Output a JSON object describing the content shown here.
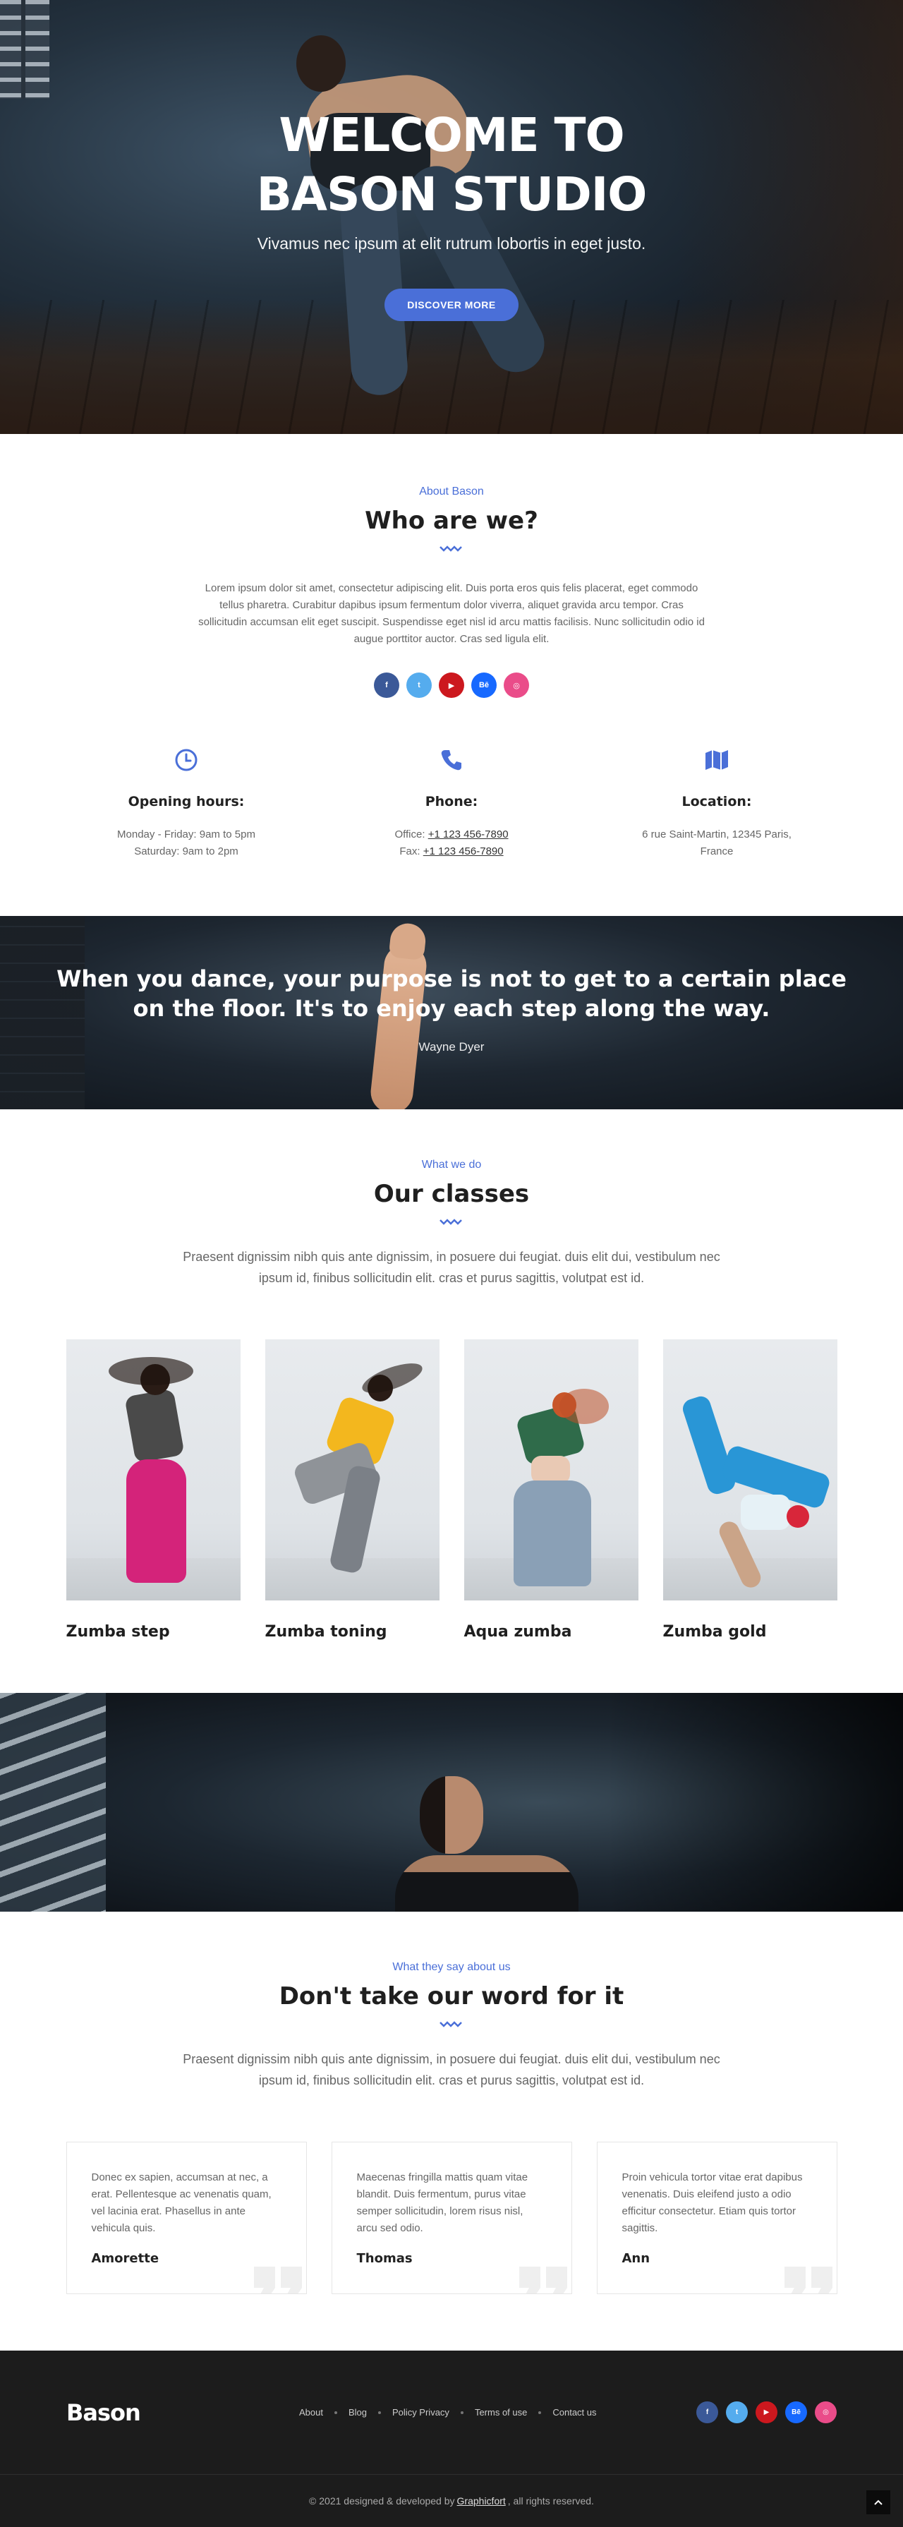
{
  "hero": {
    "title_line1": "WELCOME TO",
    "title_line2": "BASON STUDIO",
    "subtitle": "Vivamus nec ipsum at elit rutrum lobortis in eget justo.",
    "cta": "DISCOVER MORE"
  },
  "about": {
    "eyebrow": "About Bason",
    "title": "Who are we?",
    "text": "Lorem ipsum dolor sit amet, consectetur adipiscing elit. Duis porta eros quis felis placerat, eget commodo tellus pharetra. Curabitur dapibus ipsum fermentum dolor viverra, aliquet gravida arcu tempor. Cras sollicitudin accumsan elit eget suscipit. Suspendisse eget nisl id arcu mattis facilisis. Nunc sollicitudin odio id augue porttitor auctor. Cras sed ligula elit.",
    "socials": [
      {
        "icon": "facebook-icon",
        "glyph": "f",
        "color": "#3b5998"
      },
      {
        "icon": "twitter-icon",
        "glyph": "t",
        "color": "#55acee"
      },
      {
        "icon": "youtube-icon",
        "glyph": "▶",
        "color": "#cc181e"
      },
      {
        "icon": "behance-icon",
        "glyph": "Bē",
        "color": "#1769ff"
      },
      {
        "icon": "dribbble-icon",
        "glyph": "◎",
        "color": "#ea4c89"
      }
    ],
    "hours": {
      "title": "Opening hours:",
      "line1": "Monday - Friday: 9am to 5pm",
      "line2": "Saturday: 9am to 2pm"
    },
    "phone": {
      "title": "Phone:",
      "office_label": "Office:",
      "office": "+1 123 456-7890",
      "fax_label": "Fax:",
      "fax": "+1 123 456-7890"
    },
    "location": {
      "title": "Location:",
      "line1": "6 rue Saint-Martin, 12345 Paris,",
      "line2": "France"
    }
  },
  "quote": {
    "text": "When you dance, your purpose is not to get to a certain place on the floor. It's to enjoy each step along the way.",
    "author": "Wayne Dyer"
  },
  "classes": {
    "eyebrow": "What we do",
    "title": "Our classes",
    "text": "Praesent dignissim nibh quis ante dignissim, in posuere dui feugiat. duis elit dui, vestibulum nec ipsum id, finibus sollicitudin elit. cras et purus sagittis, volutpat est id.",
    "items": [
      {
        "name": "Zumba step"
      },
      {
        "name": "Zumba toning"
      },
      {
        "name": "Aqua zumba"
      },
      {
        "name": "Zumba gold"
      }
    ]
  },
  "testimonials": {
    "eyebrow": "What they say about us",
    "title": "Don't take our word for it",
    "text": "Praesent dignissim nibh quis ante dignissim, in posuere dui feugiat. duis elit dui, vestibulum nec ipsum id, finibus sollicitudin elit. cras et purus sagittis, volutpat est id.",
    "items": [
      {
        "text": "Donec ex sapien, accumsan at nec, a erat. Pellentesque ac venenatis quam, vel lacinia erat. Phasellus in ante vehicula quis.",
        "name": "Amorette"
      },
      {
        "text": "Maecenas fringilla mattis quam vitae blandit. Duis fermentum, purus vitae semper sollicitudin, lorem risus nisl, arcu sed odio.",
        "name": "Thomas"
      },
      {
        "text": "Proin vehicula tortor vitae erat dapibus venenatis. Duis eleifend justo a odio efficitur consectetur. Etiam quis tortor sagittis.",
        "name": "Ann"
      }
    ]
  },
  "footer": {
    "logo": "Bason",
    "nav": [
      "About",
      "Blog",
      "Policy Privacy",
      "Terms of use",
      "Contact us"
    ],
    "copyright_pre": "© 2021 designed & developed by",
    "copyright_link": "Graphicfort",
    "copyright_post": ", all rights reserved."
  },
  "colors": {
    "accent": "#4a6fd8",
    "footer_bg": "#1c1c1c"
  }
}
